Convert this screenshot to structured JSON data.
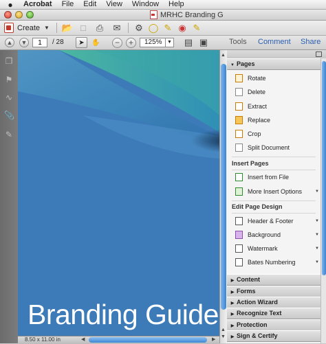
{
  "menubar": {
    "app_name": "Acrobat",
    "items": [
      "File",
      "Edit",
      "View",
      "Window",
      "Help"
    ]
  },
  "window": {
    "title": "MRHC Branding G"
  },
  "toolbar": {
    "create_label": "Create"
  },
  "nav": {
    "current_page": "1",
    "total_pages": "/ 28",
    "zoom": "125%"
  },
  "pane_tabs": {
    "tools": "Tools",
    "comment": "Comment",
    "share": "Share"
  },
  "document": {
    "title_text": "Branding Guide",
    "page_size": "8.50 x 11.00 in"
  },
  "panel": {
    "pages_header": "Pages",
    "pages_items": [
      {
        "label": "Rotate"
      },
      {
        "label": "Delete"
      },
      {
        "label": "Extract"
      },
      {
        "label": "Replace"
      },
      {
        "label": "Crop"
      },
      {
        "label": "Split Document"
      }
    ],
    "insert_label": "Insert Pages",
    "insert_items": [
      {
        "label": "Insert from File"
      },
      {
        "label": "More Insert Options"
      }
    ],
    "edit_label": "Edit Page Design",
    "edit_items": [
      {
        "label": "Header & Footer"
      },
      {
        "label": "Background"
      },
      {
        "label": "Watermark"
      },
      {
        "label": "Bates Numbering"
      }
    ],
    "sections": [
      "Content",
      "Forms",
      "Action Wizard",
      "Recognize Text",
      "Protection",
      "Sign & Certify"
    ]
  },
  "colors": {
    "doc_blue": "#3b78b7",
    "accent": "#2a5db0"
  }
}
